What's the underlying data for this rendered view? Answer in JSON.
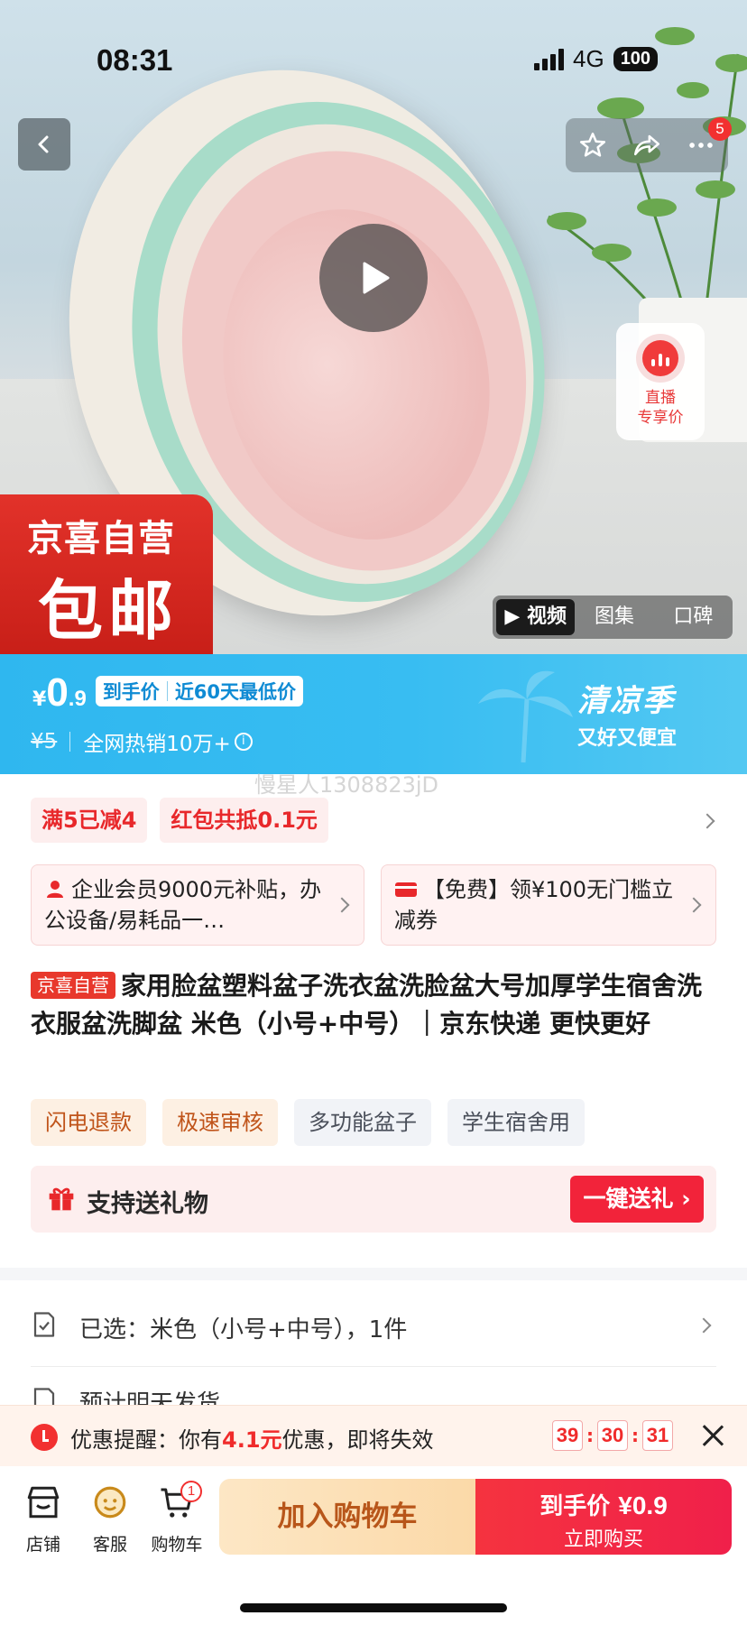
{
  "status_bar": {
    "time": "08:31",
    "network": "4G",
    "battery": "100"
  },
  "header": {
    "back_icon": "chevron-left-icon",
    "actions": [
      "star-icon",
      "share-icon",
      "more-icon"
    ],
    "notification_count": "5"
  },
  "gallery": {
    "live_label_line1": "直播",
    "live_label_line2": "专享价",
    "brand_badge_line1": "京喜自营",
    "brand_badge_line2": "包邮",
    "tabs": [
      {
        "label": "视频",
        "active": true
      },
      {
        "label": "图集",
        "active": false
      },
      {
        "label": "口碑",
        "active": false
      }
    ]
  },
  "price": {
    "currency": "¥",
    "integer": "0",
    "decimal": ".9",
    "tag_left": "到手价",
    "tag_right": "近60天最低价",
    "original": "¥5",
    "sales": "全网热销10万+",
    "season_title": "清凉季",
    "season_sub": "又好又便宜",
    "primary_color": "#35baf1"
  },
  "watermark": "慢星人1308823jD",
  "promos": [
    "满5已减4",
    "红包共抵0.1元"
  ],
  "coupons": [
    {
      "icon": "user-icon",
      "text": "企业会员9000元补贴，办公设备/易耗品一…"
    },
    {
      "icon": "coupon-icon",
      "text": "【免费】领¥100无门槛立减券"
    }
  ],
  "product": {
    "badge": "京喜自营",
    "title": "家用脸盆塑料盆子洗衣盆洗脸盆大号加厚学生宿舍洗衣服盆洗脚盆 米色（小号+中号）｜京东快递 更快更好"
  },
  "feature_tags": [
    "闪电退款",
    "极速审核",
    "多功能盆子",
    "学生宿舍用"
  ],
  "gift": {
    "label": "支持送礼物",
    "button": "一键送礼"
  },
  "specs": [
    {
      "icon": "selected-icon",
      "label": "已选：米色（小号+中号），1件"
    },
    {
      "icon": "shipping-icon",
      "label": "预计明天发货"
    }
  ],
  "reminder": {
    "prefix": "优惠提醒：你有",
    "amount": "4.1元",
    "suffix": "优惠，即将失效",
    "countdown": [
      "39",
      "30",
      "31"
    ]
  },
  "bottom_nav": [
    {
      "icon": "store-icon",
      "label": "店铺"
    },
    {
      "icon": "service-icon",
      "label": "客服"
    },
    {
      "icon": "cart-icon",
      "label": "购物车",
      "badge": "1"
    }
  ],
  "actions": {
    "add_to_cart": "加入购物车",
    "buy_label": "到手价",
    "buy_price": "¥0.9",
    "buy_now": "立即购买"
  },
  "colors": {
    "accent_red": "#f23030",
    "banner_blue": "#35baf1",
    "cart_orange": "#fbd9a8"
  }
}
